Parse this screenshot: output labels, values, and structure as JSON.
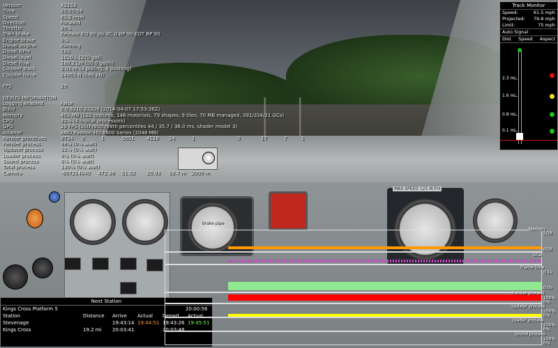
{
  "hud": {
    "rows1": [
      {
        "k": "Version",
        "v": "X2153"
      },
      {
        "k": "Time",
        "v": "20:00:56"
      },
      {
        "k": "Speed",
        "v": "61.5 mph"
      },
      {
        "k": "Direction",
        "v": "Forward"
      },
      {
        "k": "Throttle",
        "v": "80%"
      },
      {
        "k": "Train brake",
        "v": "Release EQ 90 psi BC 0 BP 90 EOT BP 90"
      },
      {
        "k": "Engine brake",
        "v": "0%"
      },
      {
        "k": "Diesel engine",
        "v": "Running"
      },
      {
        "k": "Diesel RPM",
        "v": "783"
      },
      {
        "k": "Diesel level",
        "v": "1020 L (270 gal)"
      },
      {
        "k": "Diesel flow",
        "v": "189.2 L/h (50.0 gal/h)"
      },
      {
        "k": "Coupler slack",
        "v": "0.01 m (4 pulling, 4 pushing)"
      },
      {
        "k": "Coupler force",
        "v": "24955 N (686 kN)"
      }
    ],
    "fps_label": "FPS",
    "fps_value": "29",
    "debug_header": "DEBUG INFORMATION",
    "rows2": [
      {
        "k": "Logging enabled",
        "v": "False"
      },
      {
        "k": "Build",
        "v": "0.0.5210.32208 (2014-04-07 17:53:36Z)"
      },
      {
        "k": "Memory",
        "v": "403 MB (132 textures, 146 materials, 79 shapes, 9 tiles, 70 MB managed, 391/334/21 GCs)"
      },
      {
        "k": "CPU",
        "v": "32% (4 logical processors)"
      },
      {
        "k": "GPU",
        "v": "29 FPS (50th/90th/99th percentiles 44 / 35.7 / 36.0 ms, shader model 3)"
      },
      {
        "k": "Adapter",
        "v": "AMD Radeon HD 6900 Series (2048 MB)"
      },
      {
        "k": "Render primitives",
        "v": "9734"
      },
      {
        "k": "Render process",
        "v": "98% (0% wait)"
      },
      {
        "k": "Updater process",
        "v": "32% (0% wait)"
      },
      {
        "k": "Loader process",
        "v": "0% (0% wait)"
      },
      {
        "k": "Sound process",
        "v": "0% (0% wait)"
      },
      {
        "k": "Total process",
        "v": "130% (0% wait)"
      },
      {
        "k": "Camera",
        "v": "-6072"
      }
    ],
    "render_primitive_cols": [
      "0",
      "1",
      "5651",
      "4118",
      "34",
      "1",
      "",
      "0",
      "17",
      "7",
      "1"
    ],
    "camera_cols": [
      "14940",
      "472.36",
      "51.52",
      "20.93",
      "58.7 m",
      "2000 m"
    ]
  },
  "track_monitor": {
    "title": "Track Monitor",
    "speed_label": "Speed:",
    "speed_value": "61.5 mph",
    "projected_label": "Projected:",
    "projected_value": "79.8 mph",
    "limit_label": "Limit:",
    "limit_value": "75 mph",
    "auto_signal": "Auto Signal",
    "col_dist": "Dist",
    "col_speed": "Speed",
    "col_aspect": "Aspect",
    "markers": [
      "2.3 mi",
      "1.6 mi",
      "0.8 mi",
      "0.1 mi"
    ],
    "aspects": [
      {
        "color": "#e01010"
      },
      {
        "color": "#f0e020"
      },
      {
        "color": "#20c020"
      },
      {
        "color": "#20c020"
      }
    ]
  },
  "next_station": {
    "title": "Next Station",
    "current": "Kings Cross Platform 5",
    "current_time": "20:00:56",
    "headers": {
      "station": "Station",
      "distance": "Distance",
      "arrive": "Arrive",
      "actual_a": "Actual",
      "depart": "Depart",
      "actual_d": "Actual"
    },
    "rows": [
      {
        "station": "Stevenage",
        "distance": "",
        "arrive": "19:43:14",
        "actual_a": "19:44:51",
        "depart": "19:43:26",
        "actual_d": "19:45:51"
      },
      {
        "station": "Kings Cross",
        "distance": "19.2 mi",
        "arrive": "20:03:41",
        "actual_a": "",
        "depart": "20:03:48",
        "actual_d": ""
      }
    ],
    "colors": {
      "late": "#ff9a3c",
      "ok": "#7dff5a"
    }
  },
  "graphs": {
    "memory": {
      "label": "Memory",
      "top": "2GB",
      "bottom": "0GB",
      "color": "#ff9900"
    },
    "gcs": {
      "label": "GCs",
      "color": "#cc44cc"
    },
    "frame": {
      "label": "Frame time",
      "top": "0.1s",
      "bottom": "0.0s",
      "color": "#90e890"
    },
    "render": {
      "label": "Render process",
      "top": "100%",
      "bottom": "0%",
      "color": "#ff0000"
    },
    "updater": {
      "label": "Updater process",
      "top": "100%",
      "bottom": "0%",
      "color": "#ffff00"
    },
    "loader": {
      "label": "Loader process",
      "top": "100%",
      "bottom": "0%"
    },
    "sound": {
      "label": "Sound process",
      "top": "100%",
      "bottom": "0%"
    }
  },
  "cab": {
    "speed_plate": "MAX SPEED 125 M.P.H",
    "brake_gauge_label": "brake pipe"
  }
}
